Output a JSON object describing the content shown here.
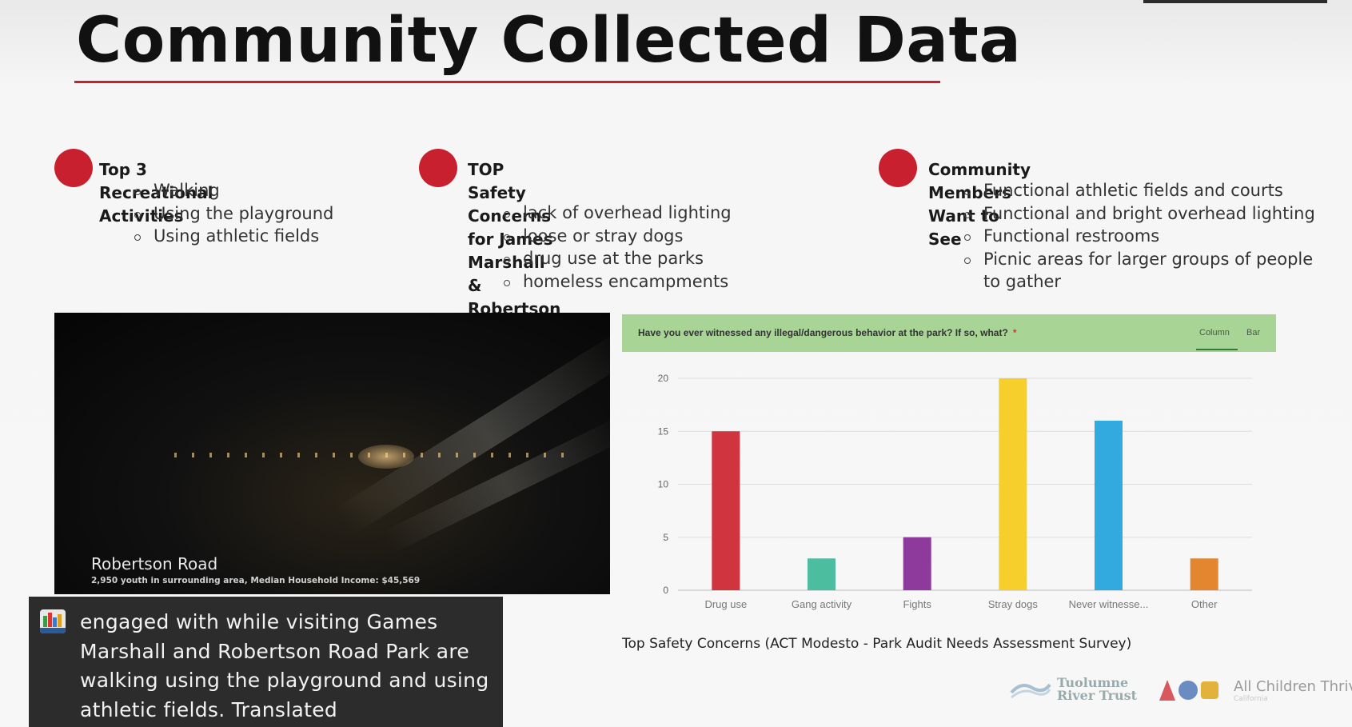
{
  "slide": {
    "title": "Community Collected Data",
    "accent_color": "#c8202f"
  },
  "sections": [
    {
      "heading_lines": [
        "Top 3 Recreational Activities"
      ],
      "bullets": [
        "Walking",
        "Using the playground",
        "Using athletic fields"
      ]
    },
    {
      "heading_lines": [
        "TOP Safety Concerns for James Marshall &",
        "Robertson Road park:"
      ],
      "bullets": [
        "lack of overhead lighting",
        "loose or stray dogs",
        "drug use at the parks",
        "homeless encampments"
      ]
    },
    {
      "heading_lines": [
        "Community Members Want to See"
      ],
      "bullets": [
        "Functional athletic fields and courts",
        "Functional and bright overhead lighting",
        "Functional restrooms",
        "Picnic areas for larger groups of people",
        "to gather"
      ]
    }
  ],
  "photo": {
    "title": "Robertson Road",
    "subtitle": "2,950 youth in surrounding area,  Median Household Income: $45,569"
  },
  "survey": {
    "question": "Have you ever witnessed any illegal/dangerous behavior at the park? If so, what?",
    "required_marker": "*",
    "tabs": [
      "Column",
      "Bar"
    ],
    "active_tab": "Column",
    "header_color": "#a8d596"
  },
  "chart_data": {
    "type": "bar",
    "categories": [
      "Drug use",
      "Gang activity",
      "Fights",
      "Stray dogs",
      "Never witnesse...",
      "Other"
    ],
    "values": [
      15,
      3,
      5,
      20,
      16,
      3
    ],
    "colors": [
      "#d0343f",
      "#4dbd9f",
      "#8e3a9c",
      "#f6cf2c",
      "#33aadf",
      "#e3862f"
    ],
    "yticks": [
      0,
      5,
      10,
      15,
      20
    ],
    "ylim": [
      0,
      20
    ],
    "grid": true,
    "title": "",
    "xlabel": "",
    "ylabel": ""
  },
  "chart_caption": "Top Safety Concerns (ACT Modesto - Park Audit Needs Assessment Survey)",
  "caption_overlay": {
    "lines": [
      "engaged with while visiting Games",
      "Marshall and Robertson Road Park are",
      "walking using the playground and using",
      "athletic fields. Translated"
    ],
    "icon": "modesto-app-icon"
  },
  "logos": {
    "tuolumne": [
      "Tuolumne",
      "River Trust"
    ],
    "act": "All Children Thrive",
    "act_sub": "California"
  }
}
